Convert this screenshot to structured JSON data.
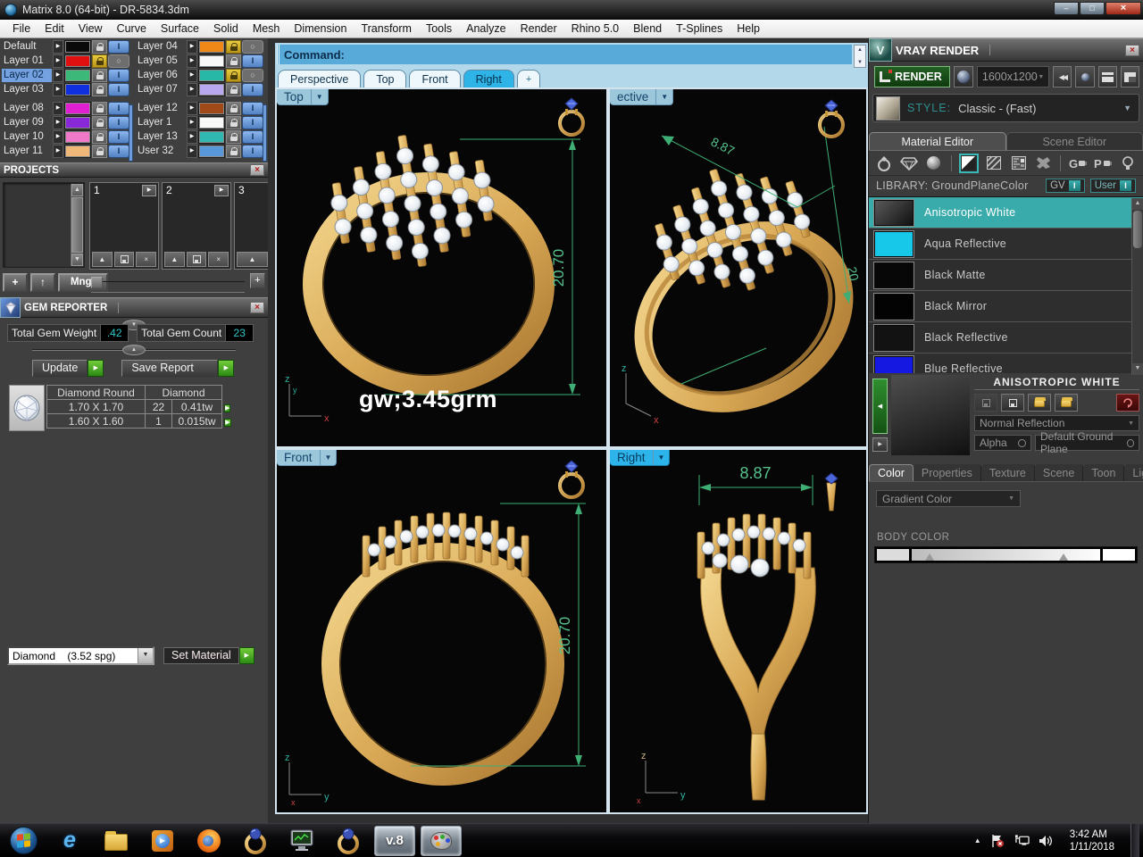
{
  "window": {
    "title": "Matrix 8.0 (64-bit) - DR-5834.3dm"
  },
  "menu": {
    "items": [
      "File",
      "Edit",
      "View",
      "Curve",
      "Surface",
      "Solid",
      "Mesh",
      "Dimension",
      "Transform",
      "Tools",
      "Analyze",
      "Render",
      "Rhino 5.0",
      "Blend",
      "T-Splines",
      "Help"
    ]
  },
  "layers": {
    "rows": [
      {
        "name": "Default",
        "color": "#0a0a0a",
        "lock": "unlocked",
        "vis": "on",
        "selected": false
      },
      {
        "name": "Layer 01",
        "color": "#e01010",
        "lock": "locked",
        "vis": "circle",
        "selected": false
      },
      {
        "name": "Layer 02",
        "color": "#3cb878",
        "lock": "unlocked",
        "vis": "on",
        "selected": true
      },
      {
        "name": "Layer 03",
        "color": "#1030e0",
        "lock": "unlocked",
        "vis": "on",
        "selected": false
      },
      {
        "name": "Layer 08",
        "color": "#e020d0",
        "lock": "unlocked",
        "vis": "on",
        "selected": false
      },
      {
        "name": "Layer 09",
        "color": "#8828d8",
        "lock": "unlocked",
        "vis": "on",
        "selected": false
      },
      {
        "name": "Layer 10",
        "color": "#f078c8",
        "lock": "unlocked",
        "vis": "on",
        "selected": false
      },
      {
        "name": "Layer 11",
        "color": "#f0b878",
        "lock": "unlocked",
        "vis": "on",
        "selected": false
      },
      {
        "name": "Layer 04",
        "color": "#f08818",
        "lock": "locked",
        "vis": "circle",
        "selected": false
      },
      {
        "name": "Layer 05",
        "color": "#f8f8f8",
        "lock": "unlocked",
        "vis": "on",
        "selected": false
      },
      {
        "name": "Layer 06",
        "color": "#28b8a8",
        "lock": "locked",
        "vis": "circle",
        "selected": false
      },
      {
        "name": "Layer 07",
        "color": "#b8a8f0",
        "lock": "unlocked",
        "vis": "on",
        "selected": false
      },
      {
        "name": "Layer 12",
        "color": "#a04818",
        "lock": "unlocked",
        "vis": "on",
        "selected": false
      },
      {
        "name": "Layer 1",
        "color": "#f8f8f8",
        "lock": "unlocked",
        "vis": "on",
        "selected": false
      },
      {
        "name": "Layer 13",
        "color": "#30b8b0",
        "lock": "unlocked",
        "vis": "on",
        "selected": false
      },
      {
        "name": "User 32",
        "color": "#5898d8",
        "lock": "unlocked",
        "vis": "on",
        "selected": false
      }
    ]
  },
  "projects": {
    "title": "PROJECTS",
    "slots": [
      "1",
      "2",
      "3"
    ],
    "add_button": "+",
    "up_button": "↑",
    "manager_button": "Mngr"
  },
  "gem_reporter": {
    "title": "GEM REPORTER",
    "weight_label": "Total Gem Weight",
    "weight_value": ".42",
    "count_label": "Total Gem Count",
    "count_value": "23",
    "update_button": "Update",
    "save_button": "Save Report",
    "table": {
      "col_shape": "Diamond Round",
      "col_material": "Diamond",
      "rows": [
        {
          "size": "1.70 X 1.70",
          "count": "22",
          "weight": "0.41tw"
        },
        {
          "size": "1.60 X 1.60",
          "count": "1",
          "weight": "0.015tw"
        }
      ]
    }
  },
  "material_bar": {
    "selected": "Diamond    (3.52 spg)",
    "set_button": "Set Material"
  },
  "command": {
    "label": "Command:"
  },
  "view_tabs": {
    "tabs": [
      "Perspective",
      "Top",
      "Front",
      "Right",
      "+"
    ],
    "active": "Right"
  },
  "viewports": {
    "top": {
      "label": "Top",
      "dim_height": "20.70",
      "annotation": "gw;3.45grm"
    },
    "perspective": {
      "label": "ective",
      "dim_width": "8.87",
      "dim_height": "20"
    },
    "front": {
      "label": "Front",
      "dim_height": "20.70"
    },
    "right": {
      "label": "Right",
      "dim_width": "8.87"
    }
  },
  "axes": {
    "x": "x",
    "y": "y",
    "z": "z"
  },
  "vray": {
    "title": "VRAY RENDER",
    "render_button": "RENDER",
    "resolution": "1600x1200",
    "style_label": "STYLE:",
    "style_value": "Classic - (Fast)",
    "editor_tabs": [
      "Material Editor",
      "Scene Editor"
    ],
    "library_label": "LIBRARY: GroundPlaneColor",
    "gv_button": "GV",
    "user_button": "User",
    "toggle_glyph": "I",
    "materials": [
      {
        "name": "Anisotropic White",
        "swatch": "linear-gradient(135deg,#5a5a5a,#101010)",
        "selected": true
      },
      {
        "name": "Aqua Reflective",
        "swatch": "#18c8e8",
        "selected": false
      },
      {
        "name": "Black Matte",
        "swatch": "#070707",
        "selected": false
      },
      {
        "name": "Black Mirror",
        "swatch": "#030303",
        "selected": false
      },
      {
        "name": "Black Reflective",
        "swatch": "#121212",
        "selected": false
      },
      {
        "name": "Blue Reflective",
        "swatch": "#1418e0",
        "selected": false
      }
    ],
    "preview_title": "ANISOTROPIC WHITE",
    "reflection_dropdown": "Normal Reflection",
    "alpha_label": "Alpha",
    "ground_label": "Default Ground Plane",
    "color_tabs": [
      "Color",
      "Properties",
      "Texture",
      "Scene",
      "Toon",
      "Light"
    ],
    "gradient_dropdown": "Gradient Color",
    "body_color_label": "BODY COLOR"
  },
  "taskbar": {
    "v8_label": "v.8",
    "time": "3:42 AM",
    "date": "1/11/2018"
  },
  "colors": {
    "accent_teal": "#3aabab",
    "dimension_green": "#3fae74",
    "gold": "#d8ac60",
    "command_blue": "#57aad8",
    "active_tab_blue": "#2fb4e8",
    "selected_layer_blue": "#74a2e0"
  }
}
